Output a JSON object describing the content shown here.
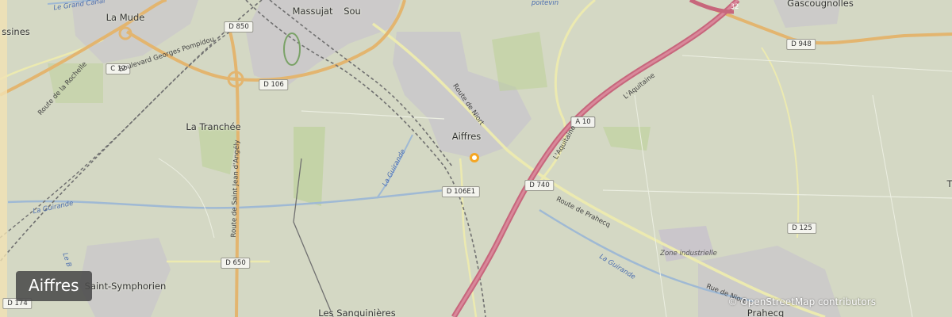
{
  "map": {
    "place_name": "Aiffres",
    "attribution": "© OpenStreetMap contributors",
    "marker": {
      "name": "Aiffres",
      "color": "#f5a623"
    },
    "colors": {
      "background": "#d4d8c4",
      "motorway": "#c7667c",
      "primary_road": "#e3b56f",
      "secondary_road": "#eceab0",
      "railway": "#707070",
      "water": "#9fb9d4",
      "urban": "#c8c6cc",
      "field": "#b7d08f"
    },
    "towns": [
      {
        "id": "la-mude",
        "label": "La Mude"
      },
      {
        "id": "massujat",
        "label": "Massujat"
      },
      {
        "id": "sou",
        "label": "Sou"
      },
      {
        "id": "gascougnolles",
        "label": "Gascougnolles"
      },
      {
        "id": "la-tranchee",
        "label": "La Tranchée"
      },
      {
        "id": "aiffres",
        "label": "Aiffres"
      },
      {
        "id": "saint-symphorien",
        "label": "Saint-Symphorien"
      },
      {
        "id": "les-sanguinieres",
        "label": "Les Sanguinières"
      },
      {
        "id": "prahecq",
        "label": "Prahecq"
      },
      {
        "id": "assines",
        "label": "ssines"
      }
    ],
    "road_shields": [
      {
        "id": "d850",
        "label": "D 850"
      },
      {
        "id": "c12",
        "label": "C 12"
      },
      {
        "id": "d106",
        "label": "D 106"
      },
      {
        "id": "d948",
        "label": "D 948"
      },
      {
        "id": "a10",
        "label": "A 10"
      },
      {
        "id": "d740",
        "label": "D 740"
      },
      {
        "id": "d106e1",
        "label": "D 106E1"
      },
      {
        "id": "d650",
        "label": "D 650"
      },
      {
        "id": "d125",
        "label": "D 125"
      },
      {
        "id": "d174",
        "label": "D 174"
      }
    ],
    "street_labels": [
      {
        "id": "bd-georges-pompidou",
        "label": "Boulevard Georges Pompidou"
      },
      {
        "id": "route-de-la-rochelle",
        "label": "Route de la Rochelle"
      },
      {
        "id": "route-st-jean",
        "label": "Route de Saint Jean d'Angély"
      },
      {
        "id": "route-de-niort-north",
        "label": "Route de Niort"
      },
      {
        "id": "laquitaine-north",
        "label": "L'Aquitaine"
      },
      {
        "id": "laquitaine-south",
        "label": "L'Aquitaine"
      },
      {
        "id": "route-de-prahecq",
        "label": "Route de Prahecq"
      },
      {
        "id": "rue-de-niort",
        "label": "Rue de Niort"
      }
    ],
    "water_labels": [
      {
        "id": "grand-canal",
        "label": "Le Grand Canal"
      },
      {
        "id": "poitevin",
        "label": "poitevin"
      },
      {
        "id": "la-guirande-1",
        "label": "La Guirande"
      },
      {
        "id": "la-guirande-2",
        "label": "La Guirande"
      },
      {
        "id": "la-guirande-3",
        "label": "La Guirande"
      },
      {
        "id": "le-b",
        "label": "Le B"
      }
    ],
    "zone_labels": [
      {
        "id": "zone-industrielle",
        "label": "Zone industrielle"
      }
    ],
    "corner_marks": [
      {
        "id": "marker-32",
        "label": "32"
      },
      {
        "id": "right-t",
        "label": "T"
      }
    ]
  }
}
